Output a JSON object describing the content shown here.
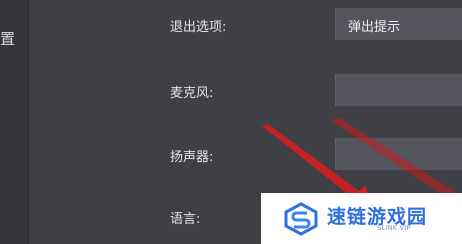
{
  "left_panel": {
    "partial_label": "置"
  },
  "settings": {
    "rows": [
      {
        "label": "退出选项:",
        "value": "弹出提示"
      },
      {
        "label": "麦克风:",
        "value": ""
      },
      {
        "label": "扬声器:",
        "value": ""
      },
      {
        "label": "语言:",
        "value": ""
      }
    ]
  },
  "watermark": {
    "title": "速链游戏园",
    "subtitle": "SLINK.VIP"
  },
  "colors": {
    "background": "#3f3f46",
    "field": "#55555d",
    "arrow": "#e02020",
    "watermark_blue": "#2f6fe0"
  },
  "icons": {
    "annotation": "red-arrow",
    "watermark_logo": "s-logo-icon"
  }
}
